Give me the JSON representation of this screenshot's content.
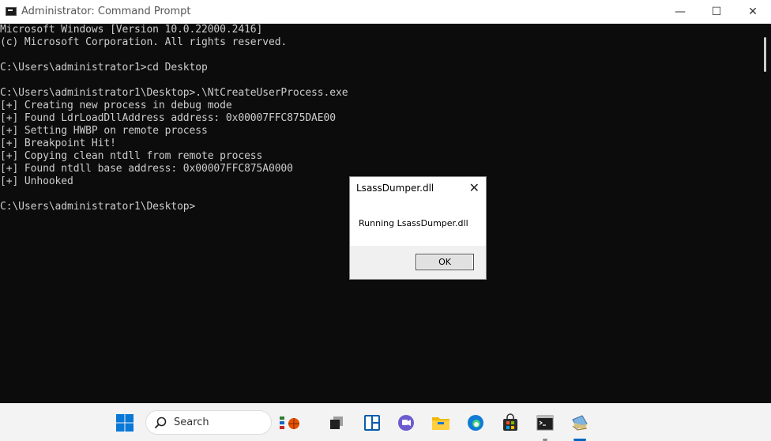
{
  "window": {
    "title": "Administrator: Command Prompt",
    "controls": {
      "minimize": "—",
      "maximize": "☐",
      "close": "✕"
    }
  },
  "console": {
    "lines": [
      "Microsoft Windows [Version 10.0.22000.2416]",
      "(c) Microsoft Corporation. All rights reserved.",
      "",
      "C:\\Users\\administrator1>cd Desktop",
      "",
      "C:\\Users\\administrator1\\Desktop>.\\NtCreateUserProcess.exe",
      "[+] Creating new process in debug mode",
      "[+] Found LdrLoadDllAddress address: 0x00007FFC875DAE00",
      "[+] Setting HWBP on remote process",
      "[+] Breakpoint Hit!",
      "[+] Copying clean ntdll from remote process",
      "[+] Found ntdll base address: 0x00007FFC875A0000",
      "[+] Unhooked",
      "",
      "C:\\Users\\administrator1\\Desktop>"
    ],
    "text_color": "#cccccc",
    "background": "#0c0c0c"
  },
  "dialog": {
    "title": "LsassDumper.dll",
    "close_glyph": "✕",
    "message": "Running LsassDumper.dll",
    "ok_label": "OK"
  },
  "taskbar": {
    "search_label": "Search",
    "icons": [
      "windows-start-icon",
      "search-icon",
      "widgets-icon",
      "task-view-icon",
      "snap-layout-icon",
      "chat-icon",
      "file-explorer-icon",
      "edge-icon",
      "store-icon",
      "command-prompt-icon",
      "app-icon"
    ],
    "accent": "#0067c0"
  }
}
